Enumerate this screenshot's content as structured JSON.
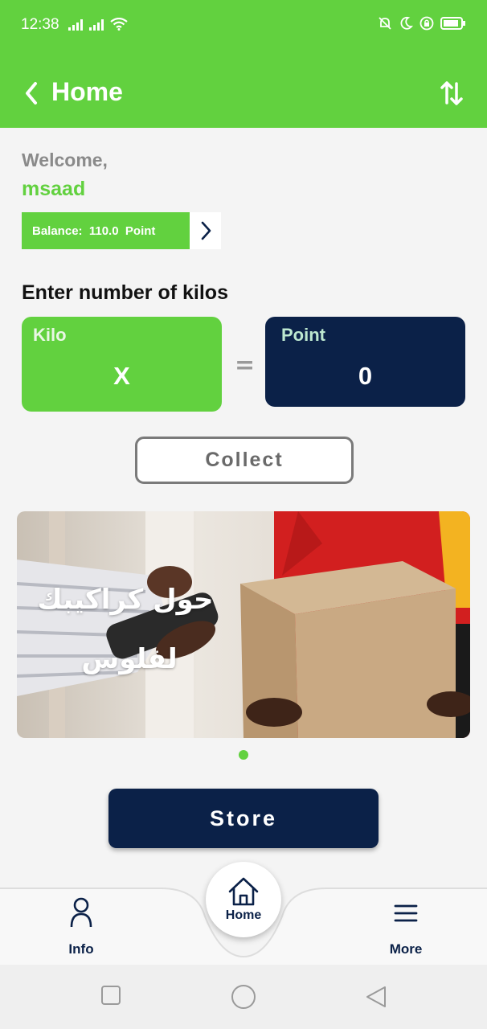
{
  "status_bar": {
    "time": "12:38",
    "left_icons": [
      "signal-icon",
      "signal-icon",
      "wifi-icon"
    ],
    "right_icons": [
      "mute-icon",
      "moon-icon",
      "lock-rotation-icon",
      "battery-icon"
    ]
  },
  "app_bar": {
    "title": "Home",
    "back_icon": "chevron-left-icon",
    "action_icon": "swap-vertical-icon"
  },
  "welcome": {
    "greeting": "Welcome,",
    "username": "msaad",
    "balance_label": "Balance:  110.0  Point"
  },
  "converter": {
    "prompt": "Enter number of kilos",
    "kilo_label": "Kilo",
    "kilo_value": "X",
    "equals": "=",
    "point_label": "Point",
    "point_value": "0"
  },
  "collect_button": "Collect",
  "banner": {
    "line1": "حول كراكيبك",
    "line2": "لفلوس"
  },
  "store_button": "Store",
  "bottom_nav": {
    "info": "Info",
    "home": "Home",
    "more": "More"
  },
  "colors": {
    "primary_green": "#62d13f",
    "navy": "#0b2148",
    "background": "#f4f4f4"
  }
}
